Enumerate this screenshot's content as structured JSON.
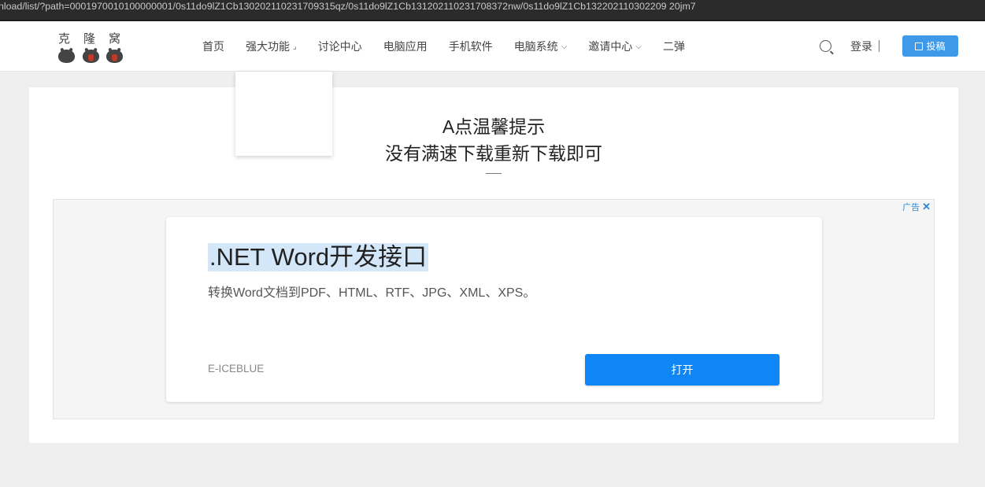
{
  "browser": {
    "url": "nload/list/?path=0001970010100000001/0s11do9lZ1Cb130202110231709315qz/0s11do9lZ1Cb131202110231708372nw/0s11do9lZ1Cb132202110302209 20jm7"
  },
  "logo": {
    "text": [
      "克",
      "隆",
      "窝"
    ]
  },
  "nav": {
    "items": [
      {
        "label": "首页"
      },
      {
        "label": "强大功能"
      },
      {
        "label": "讨论中心"
      },
      {
        "label": "电脑应用"
      },
      {
        "label": "手机软件"
      },
      {
        "label": "电脑系统"
      },
      {
        "label": "邀请中心"
      },
      {
        "label": "二弹"
      }
    ]
  },
  "header": {
    "login_label": "登录",
    "post_label": "投稿"
  },
  "main": {
    "title_line1": "A点温馨提示",
    "title_line2": "没有满速下载重新下载即可"
  },
  "ad": {
    "tag": "广告",
    "close": "✕",
    "headline": ".NET Word开发接口",
    "description": "转换Word文档到PDF、HTML、RTF、JPG、XML、XPS。",
    "brand": "E-ICEBLUE",
    "button_label": "打开"
  }
}
